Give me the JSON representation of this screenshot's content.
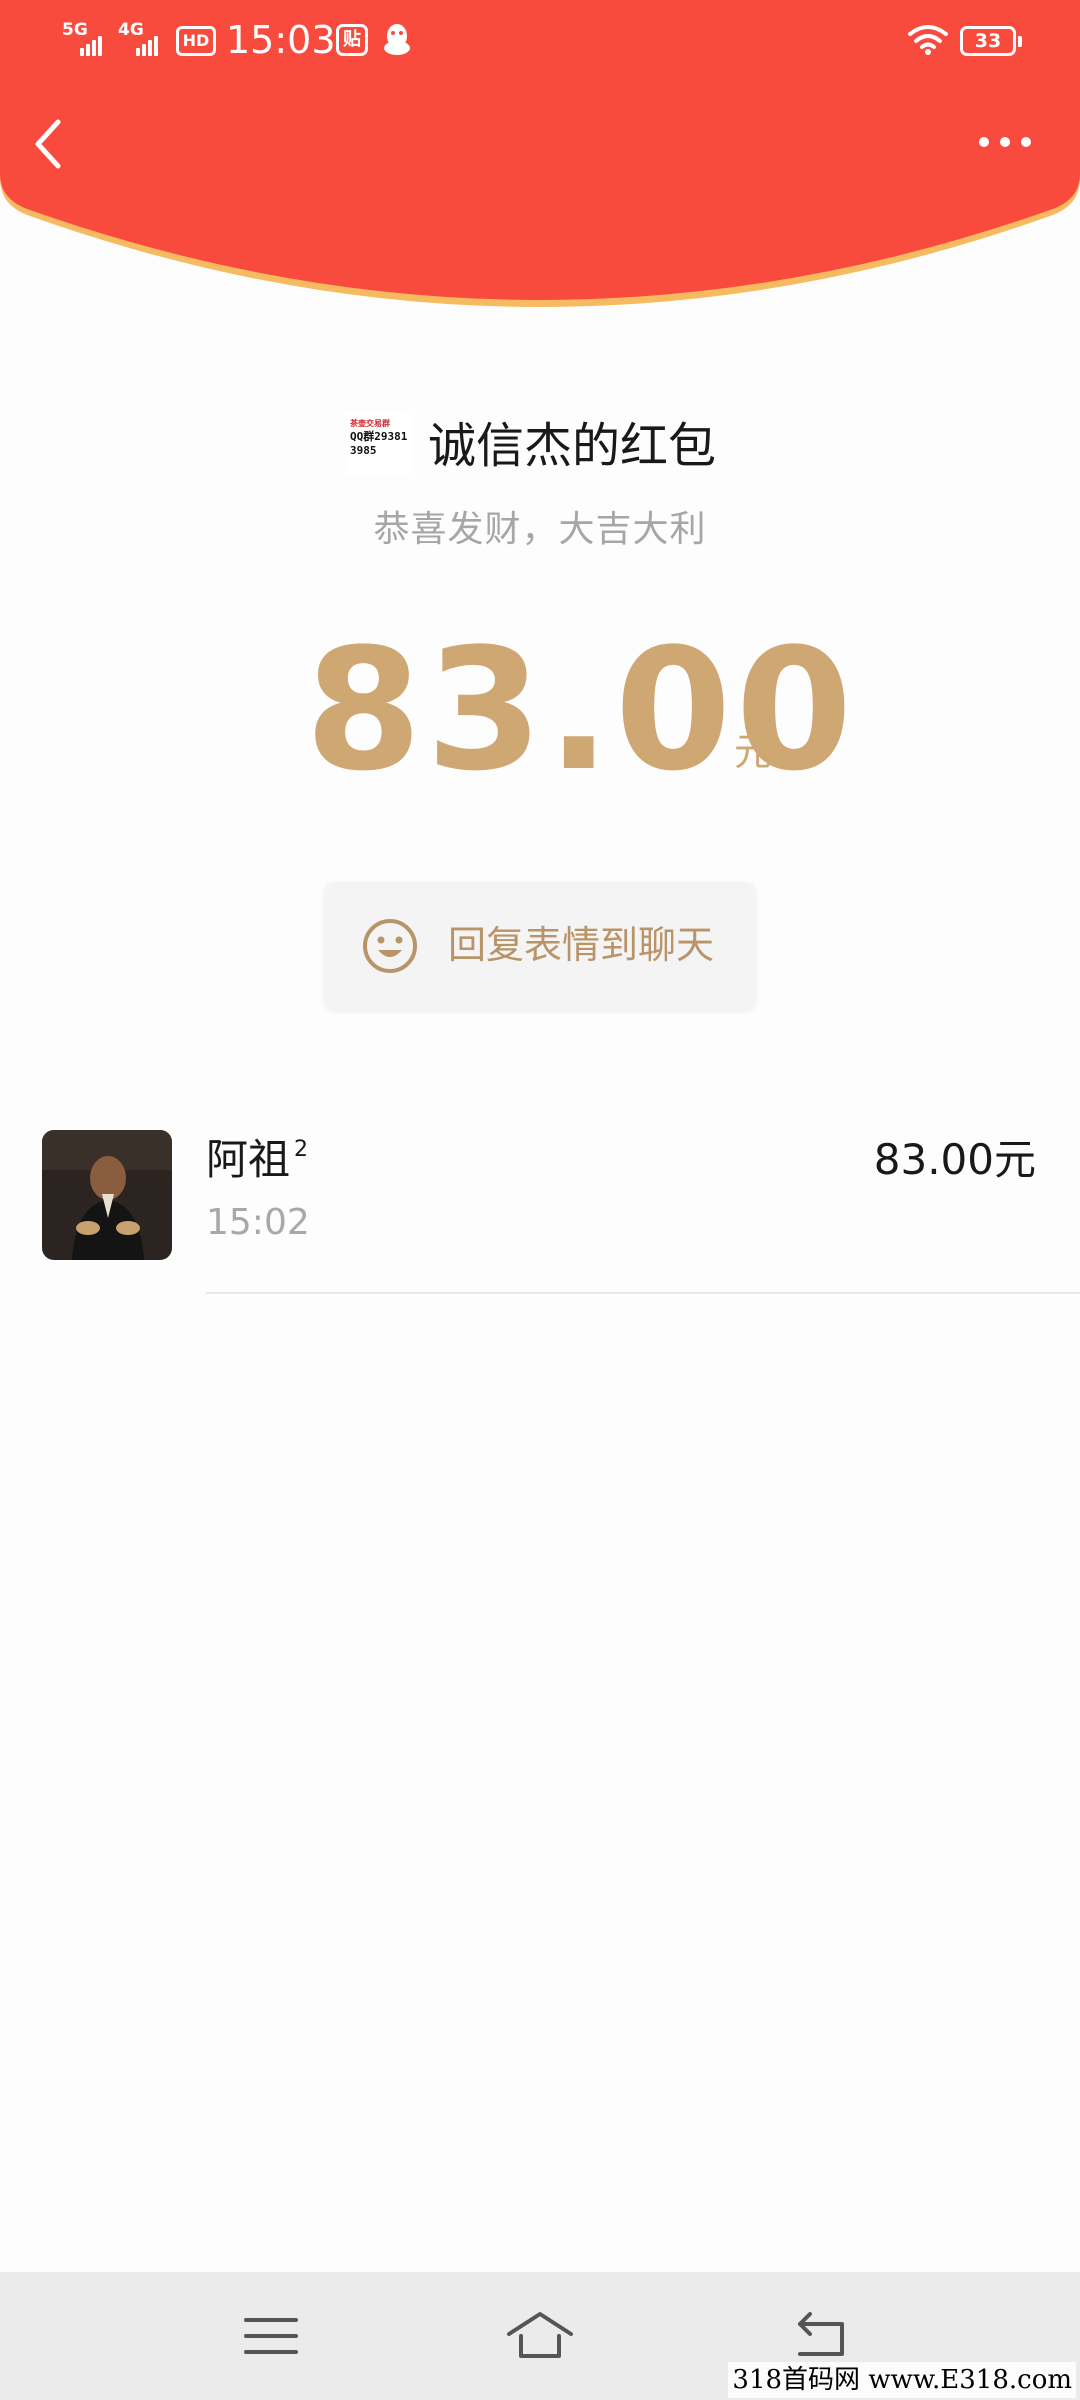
{
  "status_bar": {
    "signal_1": "5G",
    "signal_2": "4G",
    "hd_label": "HD",
    "time": "15:03",
    "tie_label": "贴",
    "battery": "33"
  },
  "header": {
    "back_icon": "chevron-left-icon",
    "more_icon": "more-dots-icon",
    "colors": {
      "red": "#f94b3d",
      "edge": "#f6bb60"
    }
  },
  "sender": {
    "avatar_lines": [
      "茶壶交易群",
      "QQ群29381",
      "3985"
    ],
    "name": "诚信杰的红包",
    "greeting": "恭喜发财，大吉大利"
  },
  "amount": {
    "value": "83.00",
    "unit": "元",
    "color": "#cfa772"
  },
  "reply": {
    "icon": "smiley-icon",
    "label": "回复表情到聊天"
  },
  "receivers": [
    {
      "name": "阿祖",
      "suffix": "2",
      "time": "15:02",
      "amount": "83.00元"
    }
  ],
  "nav": {
    "menu_icon": "menu-icon",
    "home_icon": "home-icon",
    "back_icon": "back-arrow-icon"
  },
  "watermark": "318首码网 www.E318.com"
}
